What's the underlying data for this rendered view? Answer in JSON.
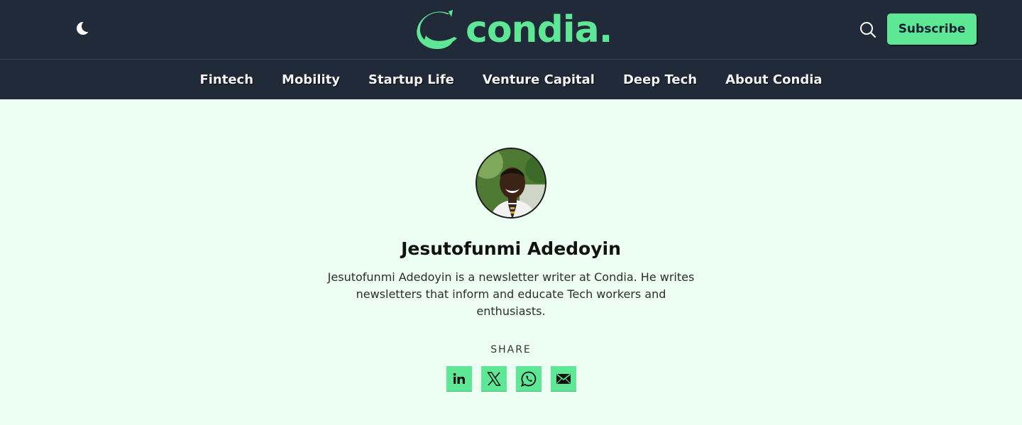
{
  "header": {
    "logo_text": "condia.",
    "subscribe_label": "Subscribe"
  },
  "nav": {
    "items": [
      {
        "label": "Fintech"
      },
      {
        "label": "Mobility"
      },
      {
        "label": "Startup Life"
      },
      {
        "label": "Venture Capital"
      },
      {
        "label": "Deep Tech"
      },
      {
        "label": "About Condia"
      }
    ]
  },
  "author": {
    "name": "Jesutofunmi Adedoyin",
    "bio": "Jesutofunmi Adedoyin is a newsletter writer at Condia. He writes newsletters that inform and educate Tech workers and enthusiasts."
  },
  "share": {
    "label": "SHARE",
    "buttons": [
      {
        "icon": "linkedin-icon"
      },
      {
        "icon": "x-icon"
      },
      {
        "icon": "whatsapp-icon"
      },
      {
        "icon": "email-icon"
      }
    ]
  },
  "colors": {
    "header_bg": "#212a38",
    "brand_green": "#5ee896",
    "page_bg": "#ecfff2"
  }
}
